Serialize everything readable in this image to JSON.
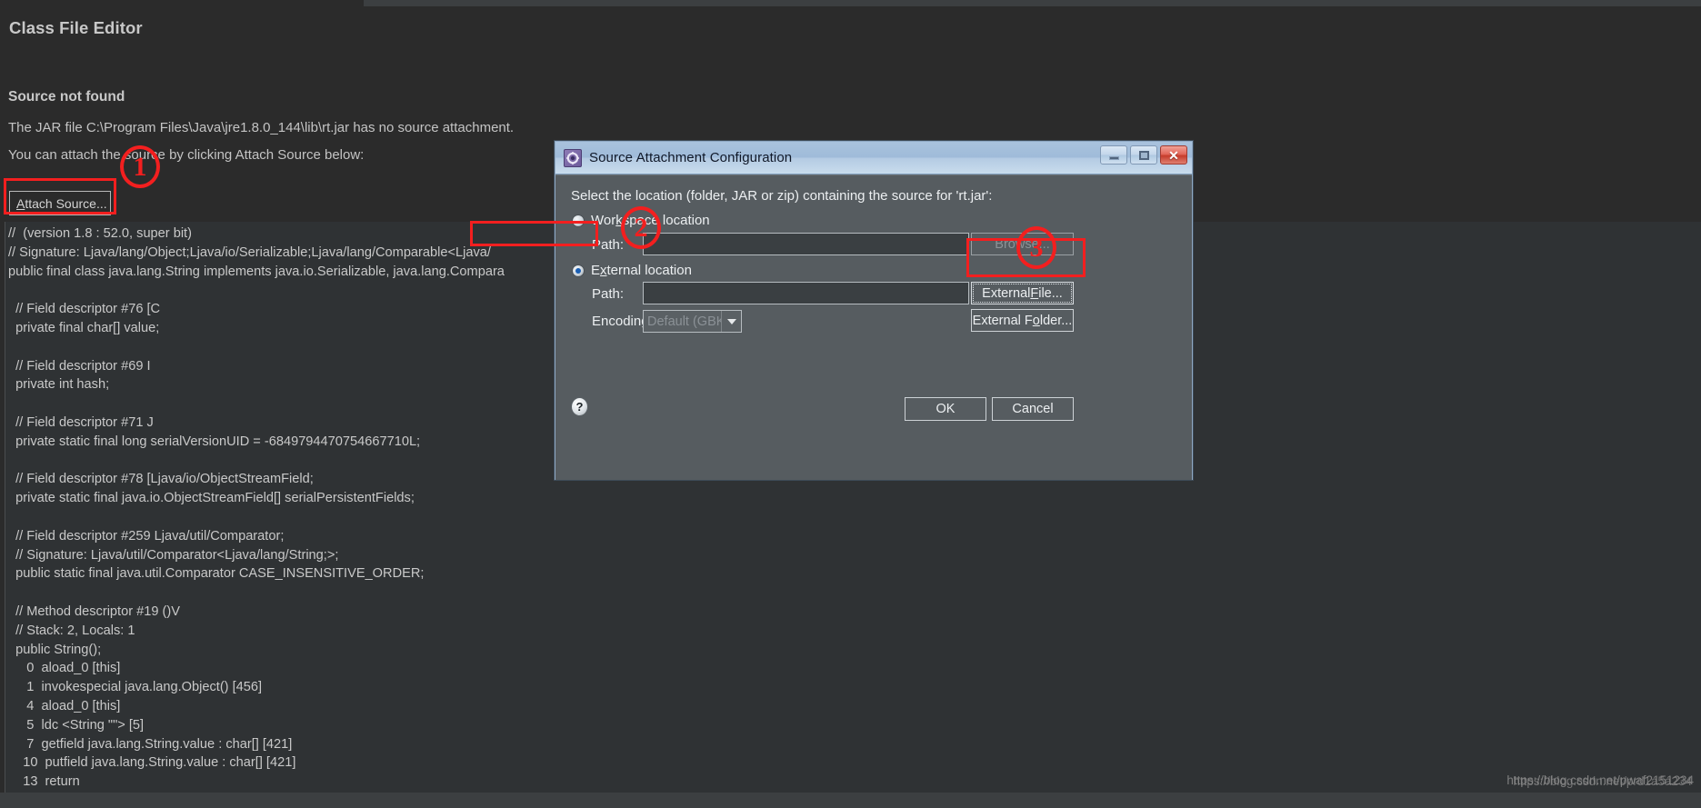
{
  "editor": {
    "page_title": "Class File Editor",
    "section_title": "Source not found",
    "body_line1": "The JAR file C:\\Program Files\\Java\\jre1.8.0_144\\lib\\rt.jar has no source attachment.",
    "body_line2": "You can attach the source by clicking Attach Source below:",
    "attach_button_mnemonic": "A",
    "attach_button_rest": "ttach Source...",
    "code": [
      "//  (version 1.8 : 52.0, super bit)",
      "// Signature: Ljava/lang/Object;Ljava/io/Serializable;Ljava/lang/Comparable<Ljava/",
      "public final class java.lang.String implements java.io.Serializable, java.lang.Compara",
      "",
      "  // Field descriptor #76 [C",
      "  private final char[] value;",
      "",
      "  // Field descriptor #69 I",
      "  private int hash;",
      "",
      "  // Field descriptor #71 J",
      "  private static final long serialVersionUID = -6849794470754667710L;",
      "",
      "  // Field descriptor #78 [Ljava/io/ObjectStreamField;",
      "  private static final java.io.ObjectStreamField[] serialPersistentFields;",
      "",
      "  // Field descriptor #259 Ljava/util/Comparator;",
      "  // Signature: Ljava/util/Comparator<Ljava/lang/String;>;",
      "  public static final java.util.Comparator CASE_INSENSITIVE_ORDER;",
      "",
      "  // Method descriptor #19 ()V",
      "  // Stack: 2, Locals: 1",
      "  public String();",
      "     0  aload_0 [this]",
      "     1  invokespecial java.lang.Object() [456]",
      "     4  aload_0 [this]",
      "     5  ldc <String \"\"> [5]",
      "     7  getfield java.lang.String.value : char[] [421]",
      "    10  putfield java.lang.String.value : char[] [421]",
      "    13  return"
    ]
  },
  "dialog": {
    "title": "Source Attachment Configuration",
    "window_buttons": {
      "minimize": "minimize",
      "maximize": "maximize",
      "close": "close"
    },
    "prompt": "Select the location (folder, JAR or zip) containing the source for 'rt.jar':",
    "workspace_radio": {
      "mnemonic_pre": "Wor",
      "mnemonic": "k",
      "mnemonic_post": "space location",
      "selected": false
    },
    "external_radio": {
      "mnemonic_pre": "E",
      "mnemonic": "x",
      "mnemonic_post": "ternal location",
      "selected": true
    },
    "workspace_path_label": "Path:",
    "workspace_path_value": "",
    "external_path_label": "Path:",
    "external_path_value": "",
    "encoding_label": "Encoding:",
    "encoding_value": "Default (GBK)",
    "buttons": {
      "browse": "Browse...",
      "external_file_pre": "External ",
      "external_file_mnemonic": "F",
      "external_file_post": "ile...",
      "external_folder_pre": "External F",
      "external_folder_mnemonic": "o",
      "external_folder_post": "lder...",
      "ok": "OK",
      "cancel": "Cancel"
    },
    "help_glyph": "?"
  },
  "annotations": {
    "step1": "1",
    "step2": "2",
    "step3": "3",
    "color": "#f31f1f"
  },
  "watermark": {
    "line_a": "https://blog.csdn.net/pwaf2151234",
    "line_b": "https://blog.csdn.net/prd1a5a234"
  }
}
